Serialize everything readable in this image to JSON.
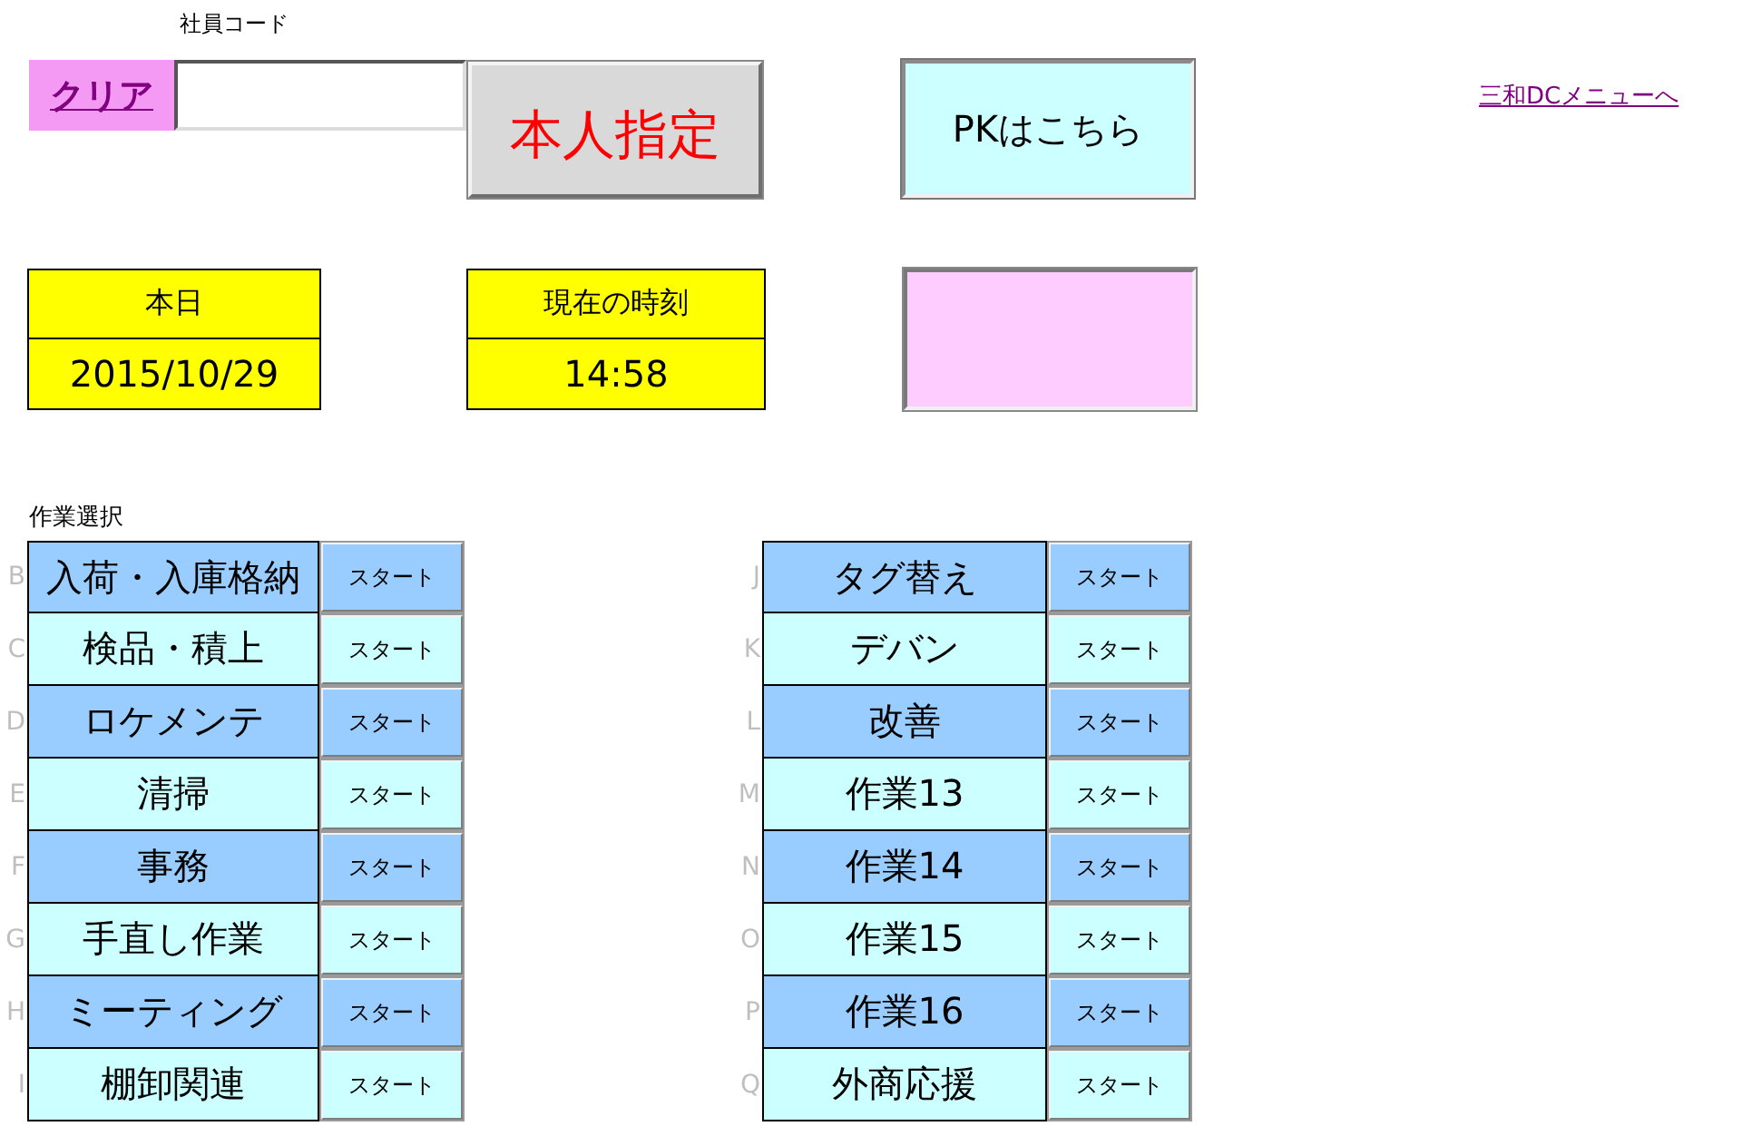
{
  "employee_code": {
    "label": "社員コード",
    "clear_button": "クリア",
    "self_button": "本人指定"
  },
  "pk_button": "PKはこちら",
  "menu_link": "三和DCメニューへ",
  "today": {
    "label": "本日",
    "value": "2015/10/29"
  },
  "current_time": {
    "label": "現在の時刻",
    "value": "14:58"
  },
  "tasks": {
    "label": "作業選択",
    "columns": [
      {
        "rows": [
          {
            "row_letter": "B",
            "name": "入荷・入庫格納",
            "button": "スタート"
          },
          {
            "row_letter": "C",
            "name": "検品・積上",
            "button": "スタート"
          },
          {
            "row_letter": "D",
            "name": "ロケメンテ",
            "button": "スタート"
          },
          {
            "row_letter": "E",
            "name": "清掃",
            "button": "スタート"
          },
          {
            "row_letter": "F",
            "name": "事務",
            "button": "スタート"
          },
          {
            "row_letter": "G",
            "name": "手直し作業",
            "button": "スタート"
          },
          {
            "row_letter": "H",
            "name": "ミーティング",
            "button": "スタート"
          },
          {
            "row_letter": "I",
            "name": "棚卸関連",
            "button": "スタート"
          }
        ]
      },
      {
        "rows": [
          {
            "row_letter": "J",
            "name": "タグ替え",
            "button": "スタート"
          },
          {
            "row_letter": "K",
            "name": "デバン",
            "button": "スタート"
          },
          {
            "row_letter": "L",
            "name": "改善",
            "button": "スタート"
          },
          {
            "row_letter": "M",
            "name": "作業13",
            "button": "スタート"
          },
          {
            "row_letter": "N",
            "name": "作業14",
            "button": "スタート"
          },
          {
            "row_letter": "O",
            "name": "作業15",
            "button": "スタート"
          },
          {
            "row_letter": "P",
            "name": "作業16",
            "button": "スタート"
          },
          {
            "row_letter": "Q",
            "name": "外商応援",
            "button": "スタート"
          }
        ]
      }
    ]
  }
}
